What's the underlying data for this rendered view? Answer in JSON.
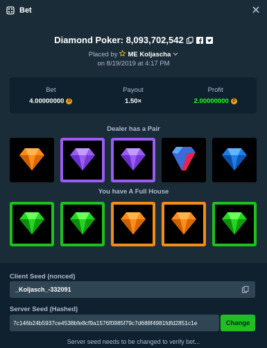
{
  "header": {
    "title": "Bet",
    "icon": "bet-icon",
    "close_icon": "close-icon"
  },
  "game": {
    "title": "Diamond Poker: 8,093,702,542",
    "placed_by_prefix": "Placed by",
    "username": "ME Koljascha",
    "date": "on 8/19/2019 at 4:17 PM"
  },
  "stats": {
    "bet_label": "Bet",
    "bet_value": "4.00000000",
    "payout_label": "Payout",
    "payout_value": "1.50×",
    "profit_label": "Profit",
    "profit_value": "2.00000000",
    "profit_color": "#1fff20",
    "coin_color": "#f0a11f"
  },
  "dealer": {
    "label": "Dealer has a Pair",
    "gems": [
      {
        "color": "orange",
        "highlight": "none"
      },
      {
        "color": "purple",
        "highlight": "purple"
      },
      {
        "color": "purple",
        "highlight": "purple"
      },
      {
        "color": "red",
        "highlight": "none"
      },
      {
        "color": "blue",
        "highlight": "none"
      }
    ]
  },
  "player": {
    "label": "You have A Full House",
    "gems": [
      {
        "color": "green",
        "highlight": "green"
      },
      {
        "color": "green",
        "highlight": "green"
      },
      {
        "color": "orange",
        "highlight": "orange"
      },
      {
        "color": "orange",
        "highlight": "orange"
      },
      {
        "color": "green",
        "highlight": "green"
      }
    ]
  },
  "seeds": {
    "client_label": "Client Seed (nonced)",
    "client_value": "_Koljasch_-332091",
    "server_label": "Server Seed (Hashed)",
    "server_value": "7c146b24b5937ce4538bfe8cf9a1576f0985f79c7d688f4981fdfd2851c1e",
    "change_label": "Change",
    "note": "Server seed needs to be changed to verify bet..."
  },
  "colors": {
    "background": "#1a2c38",
    "panel": "#0f212e",
    "input": "#2f4553",
    "accent_green": "#1fbf1f",
    "accent_purple": "#9a5cf2",
    "accent_orange": "#f28c1a"
  }
}
